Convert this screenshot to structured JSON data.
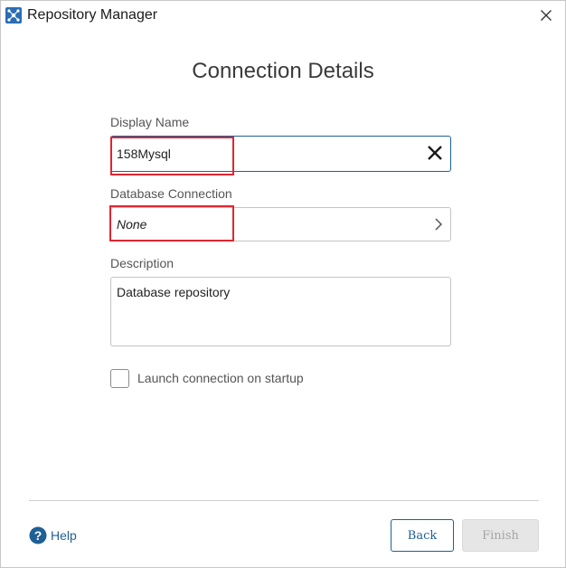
{
  "window": {
    "title": "Repository Manager",
    "app_icon": "repository-manager-icon",
    "close_icon": "close-icon"
  },
  "dialog": {
    "heading": "Connection Details",
    "display_name": {
      "label": "Display Name",
      "value": "158Mysql",
      "clear_icon": "clear-x-icon"
    },
    "database_connection": {
      "label": "Database Connection",
      "value": "None",
      "chevron_icon": "chevron-right-icon"
    },
    "description": {
      "label": "Description",
      "value": "Database repository"
    },
    "launch_on_startup": {
      "label": "Launch connection on startup",
      "checked": false
    }
  },
  "footer": {
    "help_label": "Help",
    "help_icon": "help-icon",
    "back_label": "Back",
    "finish_label": "Finish",
    "finish_enabled": false
  },
  "colors": {
    "accent": "#1f5f96",
    "highlight": "#e0262f",
    "disabled_bg": "#e6e6e6"
  }
}
